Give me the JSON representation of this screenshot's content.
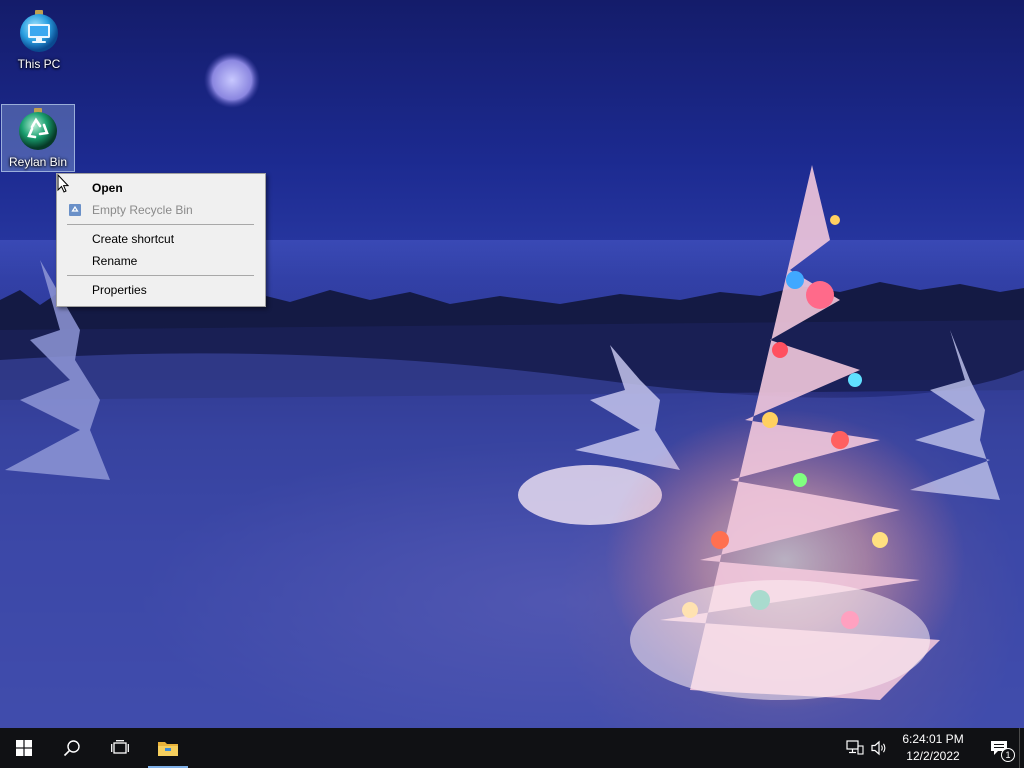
{
  "desktop": {
    "icons": [
      {
        "label": "This PC",
        "icon": "monitor-ornament-icon"
      },
      {
        "label": "Reylan Bin",
        "icon": "recycle-ornament-icon",
        "selected": true
      }
    ]
  },
  "context_menu": {
    "items": [
      {
        "label": "Open",
        "bold": true
      },
      {
        "label": "Empty Recycle Bin",
        "disabled": true,
        "icon": "recycle-bin-icon"
      },
      {
        "label": "Create shortcut"
      },
      {
        "label": "Rename"
      },
      {
        "label": "Properties"
      }
    ]
  },
  "taskbar": {
    "buttons": [
      {
        "name": "start",
        "icon": "windows-logo-icon"
      },
      {
        "name": "search",
        "icon": "search-icon"
      },
      {
        "name": "task-view",
        "icon": "task-view-icon"
      },
      {
        "name": "file-explorer",
        "icon": "folder-icon",
        "active": true
      }
    ],
    "tray": {
      "network_icon": "network-icon",
      "volume_icon": "volume-icon",
      "time": "6:24:01 PM",
      "date": "12/2/2022",
      "notification_count": "1"
    }
  },
  "colors": {
    "taskbar_bg": "#101114",
    "menu_bg": "#f0f0f0",
    "accent": "#7fb0e8"
  }
}
